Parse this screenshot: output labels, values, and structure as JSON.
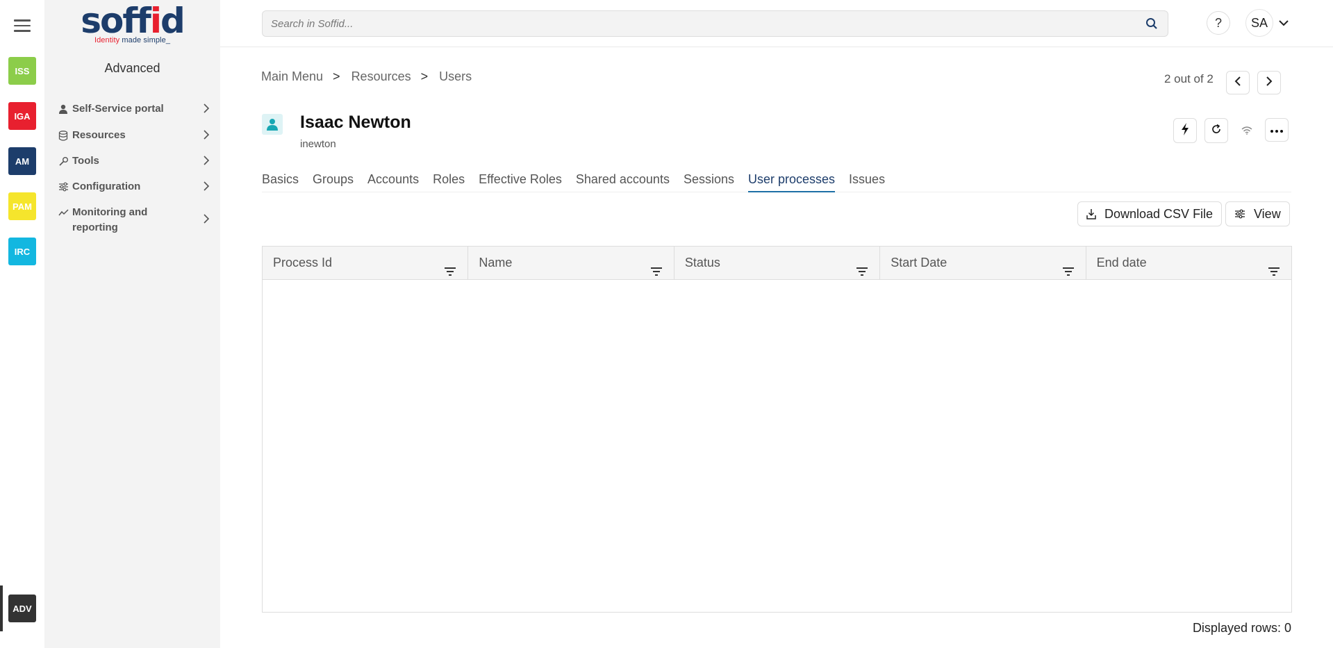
{
  "rail": {
    "apps": [
      {
        "label": "ISS",
        "color": "#8ccd4a"
      },
      {
        "label": "IGA",
        "color": "#e8202f"
      },
      {
        "label": "AM",
        "color": "#1d3d6b"
      },
      {
        "label": "PAM",
        "color": "#f5e52c"
      },
      {
        "label": "IRC",
        "color": "#13b7e0"
      }
    ],
    "current": {
      "label": "ADV",
      "color": "#333333"
    }
  },
  "logo": {
    "word_parts": [
      "soff",
      "i",
      "d"
    ],
    "tagline_red": "Identity",
    "tagline_rest": " made simple_"
  },
  "sidebar": {
    "title": "Advanced",
    "items": [
      {
        "label": "Self-Service portal",
        "icon": "person-icon"
      },
      {
        "label": "Resources",
        "icon": "database-icon"
      },
      {
        "label": "Tools",
        "icon": "wrench-icon"
      },
      {
        "label": "Configuration",
        "icon": "sliders-icon"
      },
      {
        "label": "Monitoring and reporting",
        "icon": "chart-line-icon"
      }
    ]
  },
  "topbar": {
    "search_placeholder": "Search in Soffid...",
    "help_label": "?",
    "user_initials": "SA"
  },
  "breadcrumb": [
    "Main Menu",
    "Resources",
    "Users"
  ],
  "breadcrumb_sep": ">",
  "pager": {
    "text": "2 out of 2"
  },
  "user": {
    "name": "Isaac Newton",
    "login": "inewton"
  },
  "tabs": [
    {
      "label": "Basics",
      "active": false
    },
    {
      "label": "Groups",
      "active": false
    },
    {
      "label": "Accounts",
      "active": false
    },
    {
      "label": "Roles",
      "active": false
    },
    {
      "label": "Effective Roles",
      "active": false
    },
    {
      "label": "Shared accounts",
      "active": false
    },
    {
      "label": "Sessions",
      "active": false
    },
    {
      "label": "User processes",
      "active": true
    },
    {
      "label": "Issues",
      "active": false
    }
  ],
  "actions": {
    "download_label": "Download CSV File",
    "view_label": "View"
  },
  "table": {
    "columns": [
      "Process Id",
      "Name",
      "Status",
      "Start Date",
      "End date"
    ],
    "rows": []
  },
  "footer": {
    "displayed_rows": "Displayed rows: 0"
  }
}
